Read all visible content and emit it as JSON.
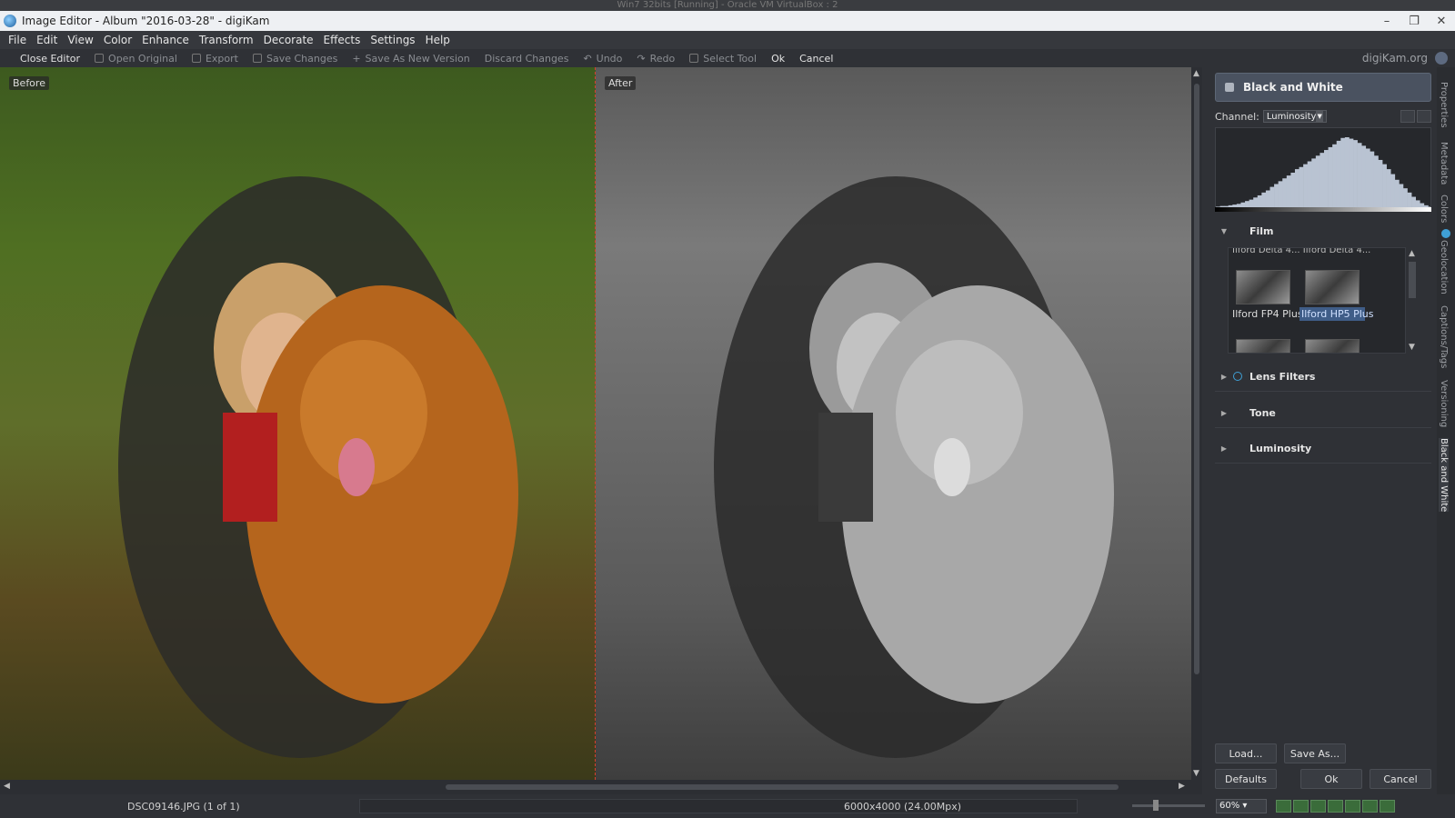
{
  "vbox_title": "Win7 32bits [Running] - Oracle VM VirtualBox : 2",
  "window": {
    "title": "Image Editor - Album \"2016-03-28\" - digiKam"
  },
  "menu": [
    "File",
    "Edit",
    "View",
    "Color",
    "Enhance",
    "Transform",
    "Decorate",
    "Effects",
    "Settings",
    "Help"
  ],
  "toolbar": {
    "close_editor": "Close Editor",
    "open_original": "Open Original",
    "export": "Export",
    "save_changes": "Save Changes",
    "save_as_new_version": "Save As New Version",
    "discard_changes": "Discard Changes",
    "undo": "Undo",
    "redo": "Redo",
    "select_tool": "Select Tool",
    "ok": "Ok",
    "cancel": "Cancel",
    "brand": "digiKam.org"
  },
  "canvas": {
    "before_label": "Before",
    "after_label": "After"
  },
  "panel": {
    "title": "Black and White",
    "channel_label": "Channel:",
    "channel_value": "Luminosity",
    "sections": {
      "film": "Film",
      "lens_filters": "Lens Filters",
      "tone": "Tone",
      "luminosity": "Luminosity"
    },
    "film_cut_text": "Ilford Delta 4...  Ilford Delta 4...",
    "film_items": [
      "Ilford FP4 Plus",
      "Ilford HP5 Plus"
    ],
    "buttons": {
      "load": "Load...",
      "save_as": "Save As...",
      "defaults": "Defaults",
      "ok": "Ok",
      "cancel": "Cancel"
    }
  },
  "side_tabs": [
    "Properties",
    "Metadata",
    "Colors",
    "Geolocation",
    "Captions/Tags",
    "Versioning",
    "Black and White"
  ],
  "status": {
    "file": "DSC09146.JPG (1 of 1)",
    "dimensions": "6000x4000 (24.00Mpx)",
    "zoom": "60%"
  },
  "histogram_bins": [
    2,
    3,
    3,
    4,
    5,
    6,
    8,
    10,
    12,
    15,
    18,
    22,
    25,
    30,
    34,
    38,
    42,
    46,
    50,
    55,
    58,
    62,
    66,
    70,
    74,
    78,
    82,
    86,
    90,
    95,
    99,
    100,
    98,
    96,
    92,
    88,
    84,
    80,
    74,
    68,
    62,
    55,
    48,
    40,
    34,
    28,
    22,
    16,
    11,
    7,
    4,
    2
  ]
}
